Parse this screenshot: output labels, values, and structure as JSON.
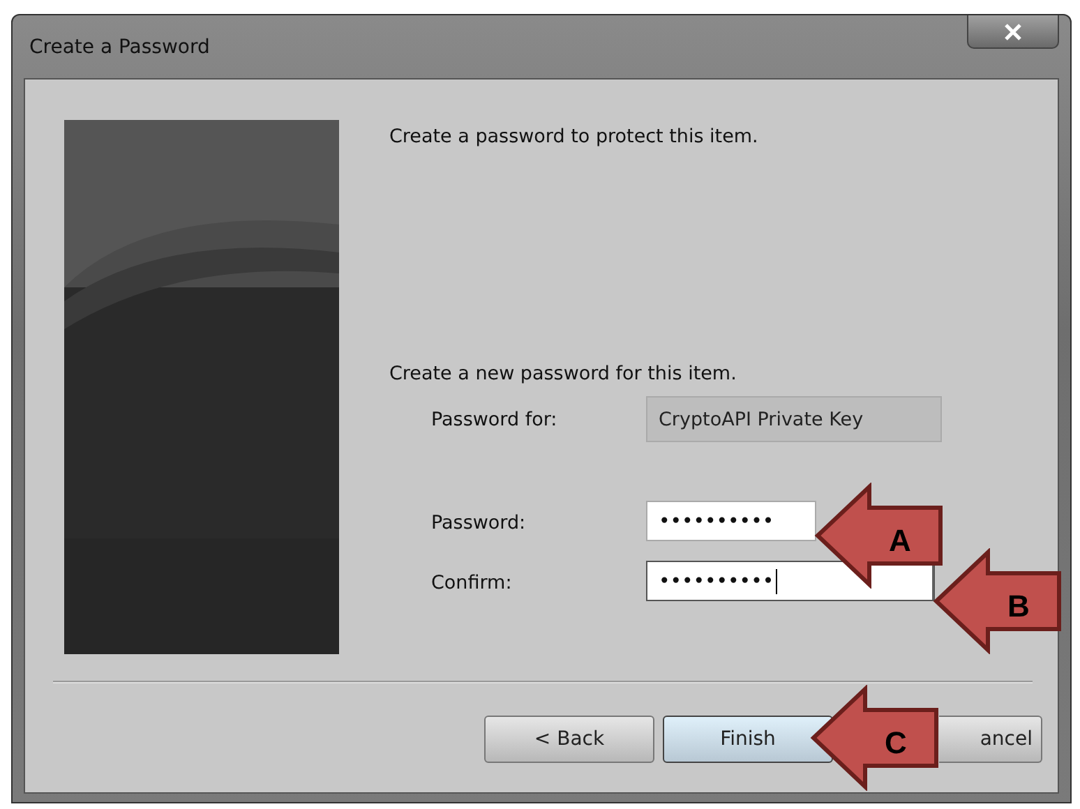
{
  "window": {
    "title": "Create a Password"
  },
  "intro": "Create a password to protect this item.",
  "section_label": "Create a new password for this item.",
  "fields": [
    {
      "label": "Password for:",
      "value": "CryptoAPI Private Key",
      "kind": "readonly",
      "focused": false
    },
    {
      "label": "Password:",
      "value": "••••••••••",
      "kind": "password",
      "focused": false
    },
    {
      "label": "Confirm:",
      "value": "••••••••••",
      "kind": "password",
      "focused": true
    }
  ],
  "buttons": [
    {
      "label": "< Back",
      "default": false
    },
    {
      "label": "Finish",
      "default": true
    },
    {
      "label": "ancel",
      "default": false
    }
  ],
  "callouts": [
    {
      "label": "A"
    },
    {
      "label": "B"
    },
    {
      "label": "C"
    }
  ]
}
